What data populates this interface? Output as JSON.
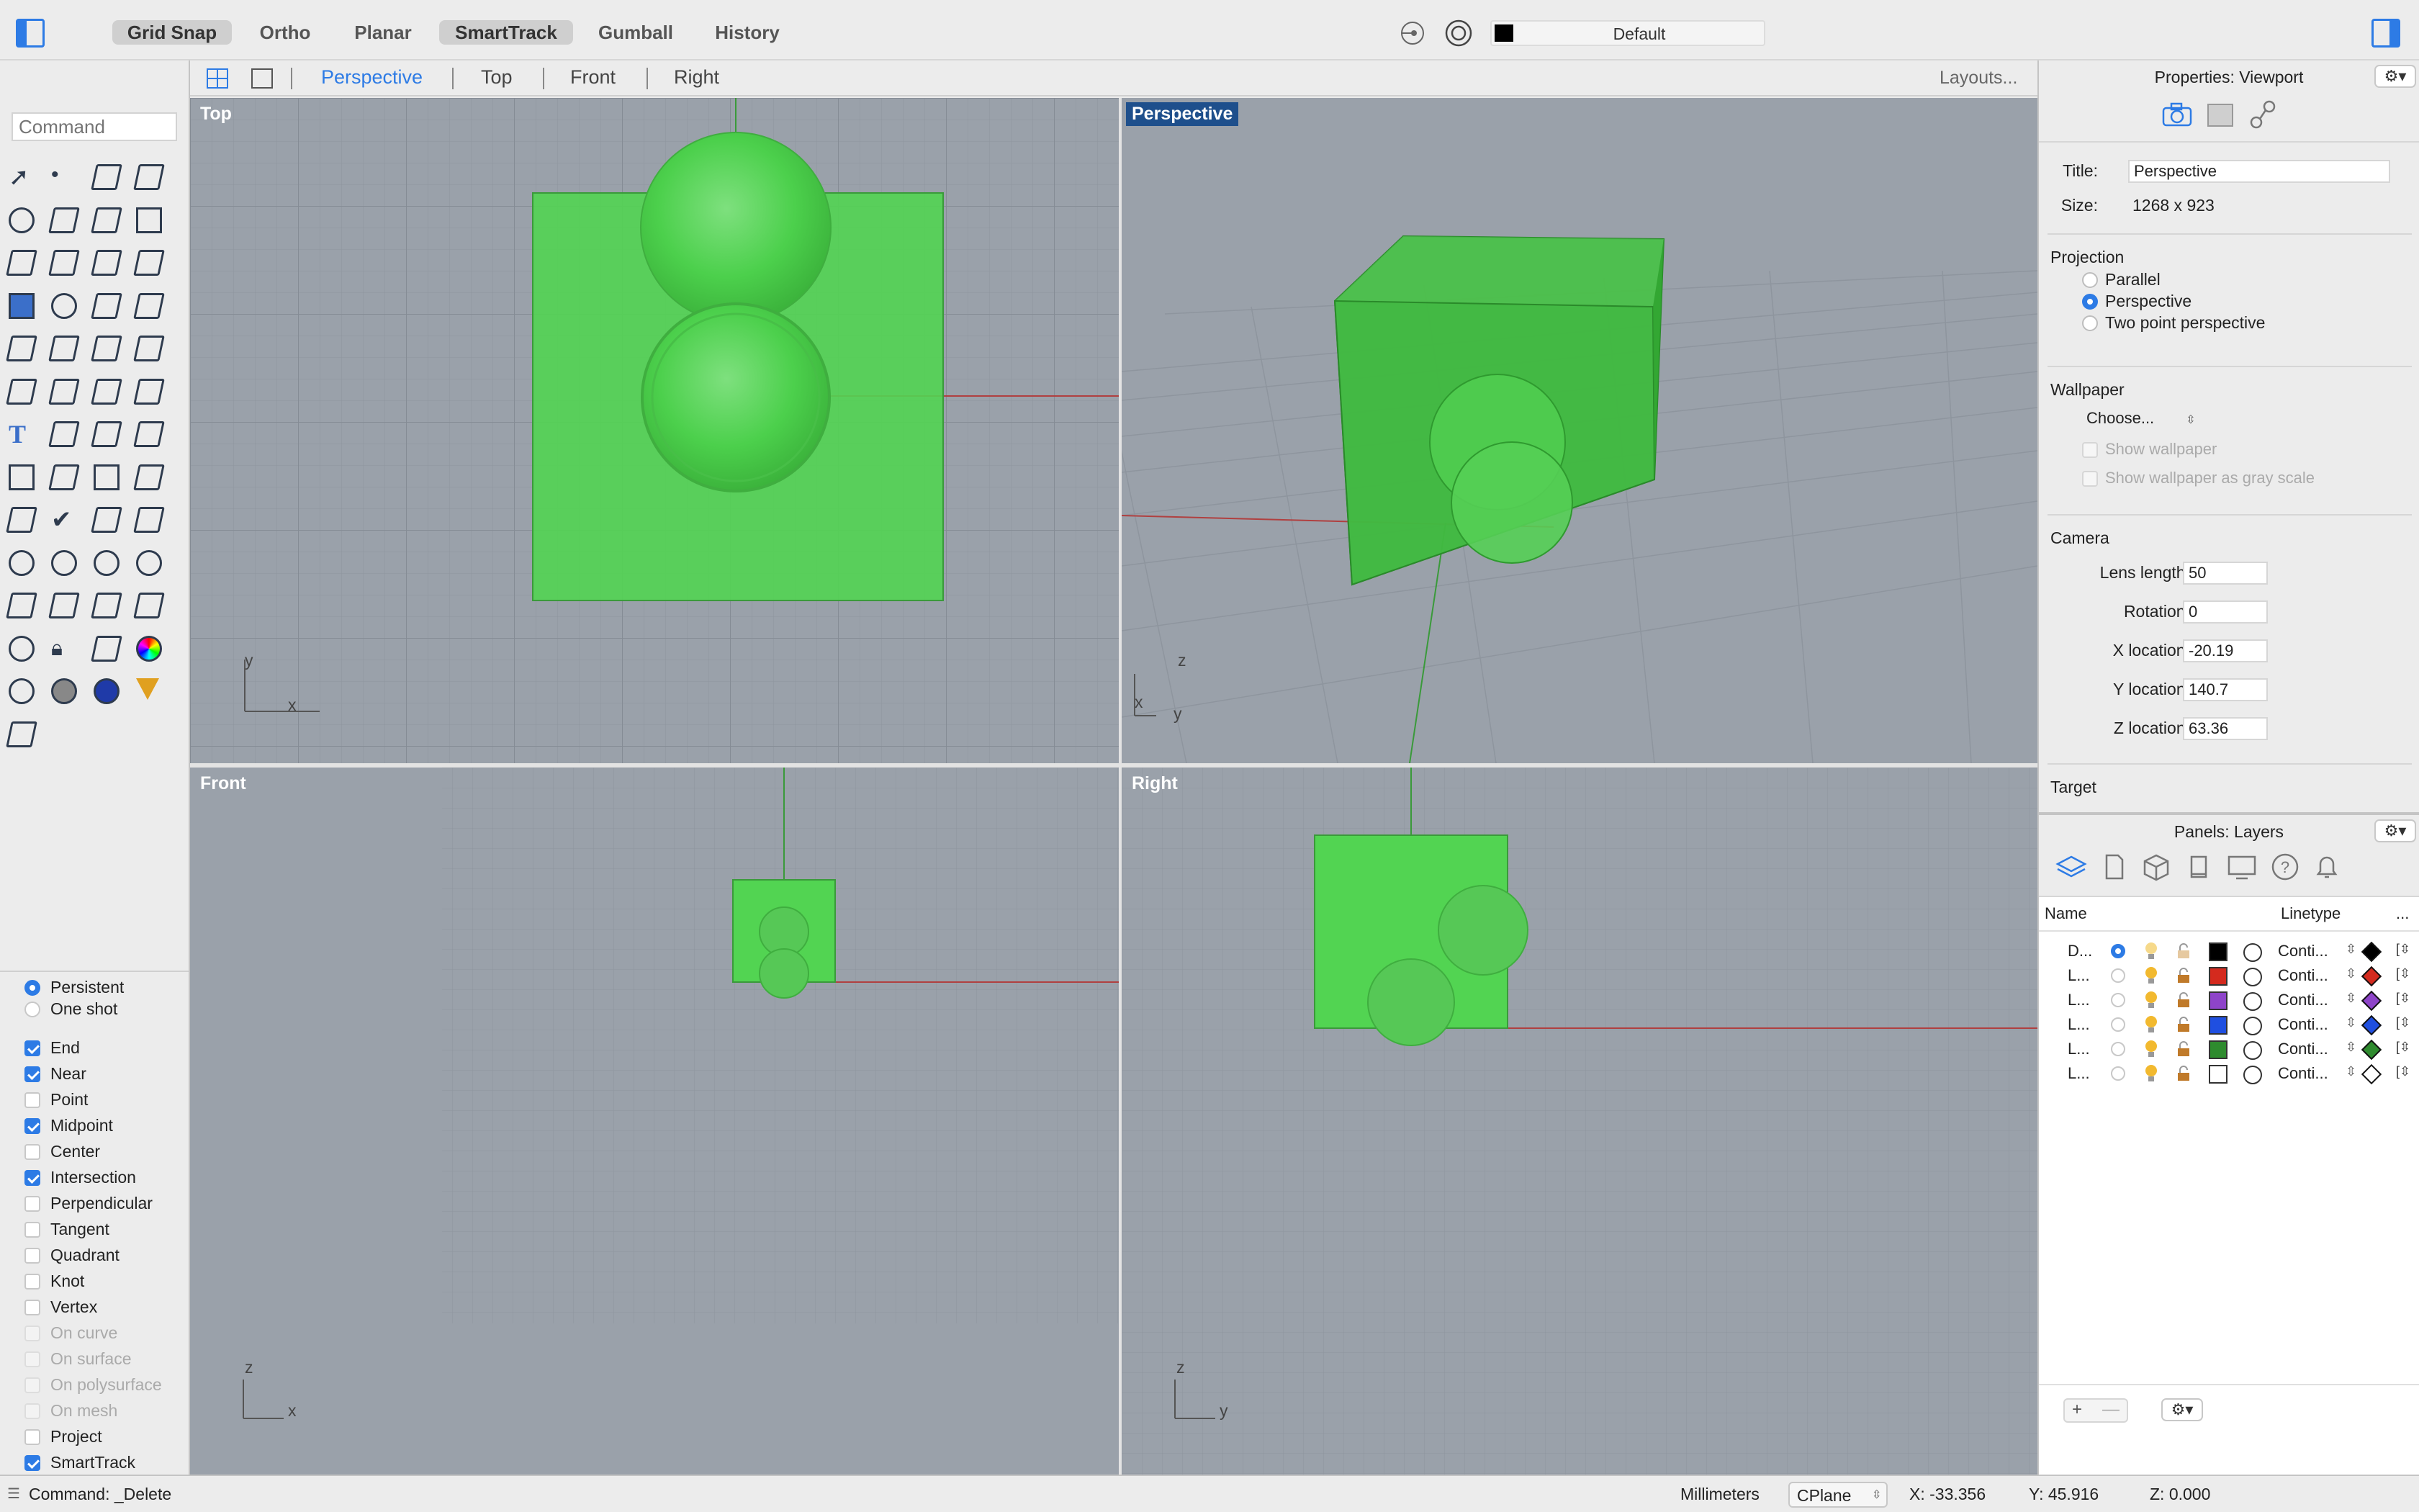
{
  "toolbar": {
    "toggles": [
      {
        "label": "Grid Snap",
        "on": true
      },
      {
        "label": "Ortho",
        "on": false
      },
      {
        "label": "Planar",
        "on": false
      },
      {
        "label": "SmartTrack",
        "on": true
      },
      {
        "label": "Gumball",
        "on": false
      },
      {
        "label": "History",
        "on": false
      }
    ],
    "layer_name": "Default"
  },
  "viewport_tabs": {
    "tabs": [
      "Perspective",
      "Top",
      "Front",
      "Right"
    ],
    "active": "Perspective",
    "layouts_label": "Layouts..."
  },
  "command": {
    "placeholder": "Command"
  },
  "viewports": {
    "top": {
      "label": "Top",
      "axis_labels": [
        "y",
        "x"
      ]
    },
    "perspective": {
      "label": "Perspective",
      "axis_labels": [
        "z",
        "x",
        "y"
      ]
    },
    "front": {
      "label": "Front",
      "axis_labels": [
        "z",
        "x"
      ]
    },
    "right": {
      "label": "Right",
      "axis_labels": [
        "z",
        "y"
      ]
    }
  },
  "osnaps": {
    "mode": [
      {
        "label": "Persistent",
        "selected": true
      },
      {
        "label": "One shot",
        "selected": false
      }
    ],
    "items": [
      {
        "label": "End",
        "checked": true,
        "enabled": true
      },
      {
        "label": "Near",
        "checked": true,
        "enabled": true
      },
      {
        "label": "Point",
        "checked": false,
        "enabled": true
      },
      {
        "label": "Midpoint",
        "checked": true,
        "enabled": true
      },
      {
        "label": "Center",
        "checked": false,
        "enabled": true
      },
      {
        "label": "Intersection",
        "checked": true,
        "enabled": true
      },
      {
        "label": "Perpendicular",
        "checked": false,
        "enabled": true
      },
      {
        "label": "Tangent",
        "checked": false,
        "enabled": true
      },
      {
        "label": "Quadrant",
        "checked": false,
        "enabled": true
      },
      {
        "label": "Knot",
        "checked": false,
        "enabled": true
      },
      {
        "label": "Vertex",
        "checked": false,
        "enabled": true
      },
      {
        "label": "On curve",
        "checked": false,
        "enabled": false
      },
      {
        "label": "On surface",
        "checked": false,
        "enabled": false
      },
      {
        "label": "On polysurface",
        "checked": false,
        "enabled": false
      },
      {
        "label": "On mesh",
        "checked": false,
        "enabled": false
      },
      {
        "label": "Project",
        "checked": false,
        "enabled": true
      },
      {
        "label": "SmartTrack",
        "checked": true,
        "enabled": true
      }
    ]
  },
  "properties": {
    "header": "Properties: Viewport",
    "title_label": "Title:",
    "title_value": "Perspective",
    "size_label": "Size:",
    "size_value": "1268 x 923",
    "projection": {
      "heading": "Projection",
      "options": [
        {
          "label": "Parallel",
          "selected": false
        },
        {
          "label": "Perspective",
          "selected": true
        },
        {
          "label": "Two point perspective",
          "selected": false
        }
      ]
    },
    "wallpaper": {
      "heading": "Wallpaper",
      "choose": "Choose...",
      "show": "Show wallpaper",
      "gray": "Show wallpaper as gray scale"
    },
    "camera": {
      "heading": "Camera",
      "fields": [
        {
          "label": "Lens length:",
          "value": "50"
        },
        {
          "label": "Rotation:",
          "value": "0"
        },
        {
          "label": "X location:",
          "value": "-20.19"
        },
        {
          "label": "Y location:",
          "value": "140.7"
        },
        {
          "label": "Z location:",
          "value": "63.36"
        }
      ]
    },
    "target_heading": "Target"
  },
  "layers": {
    "header": "Panels: Layers",
    "col_name": "Name",
    "col_linetype": "Linetype",
    "col_more": "...",
    "rows": [
      {
        "name": "D...",
        "current": true,
        "color": "#000000",
        "linetype": "Conti...",
        "print_color": "#000000"
      },
      {
        "name": "L...",
        "current": false,
        "color": "#d42a1e",
        "linetype": "Conti...",
        "print_color": "#d42a1e"
      },
      {
        "name": "L...",
        "current": false,
        "color": "#8e44c9",
        "linetype": "Conti...",
        "print_color": "#8e44c9"
      },
      {
        "name": "L...",
        "current": false,
        "color": "#1f4fe0",
        "linetype": "Conti...",
        "print_color": "#1f4fe0"
      },
      {
        "name": "L...",
        "current": false,
        "color": "#2e8b2e",
        "linetype": "Conti...",
        "print_color": "#2e8b2e"
      },
      {
        "name": "L...",
        "current": false,
        "color": "#ffffff",
        "linetype": "Conti...",
        "print_color": "#ffffff"
      }
    ],
    "add": "+",
    "remove": "—"
  },
  "status": {
    "command": "Command: _Delete",
    "units": "Millimeters",
    "cplane": "CPlane",
    "x": "X: -33.356",
    "y": "Y: 45.916",
    "z": "Z: 0.000"
  },
  "colors": {
    "accent": "#2d7be5",
    "object_green": "#4cd04c",
    "viewport_bg": "#9aa1aa"
  },
  "icons": [
    "panel-toggle-left-icon",
    "panel-toggle-right-icon",
    "record-icon",
    "target-icon",
    "four-view-icon",
    "single-view-icon",
    "camera-icon",
    "display-icon",
    "link-icon",
    "layers-icon",
    "document-icon",
    "cube-icon",
    "page-icon",
    "monitor-icon",
    "help-icon",
    "bell-icon",
    "gear-icon"
  ]
}
